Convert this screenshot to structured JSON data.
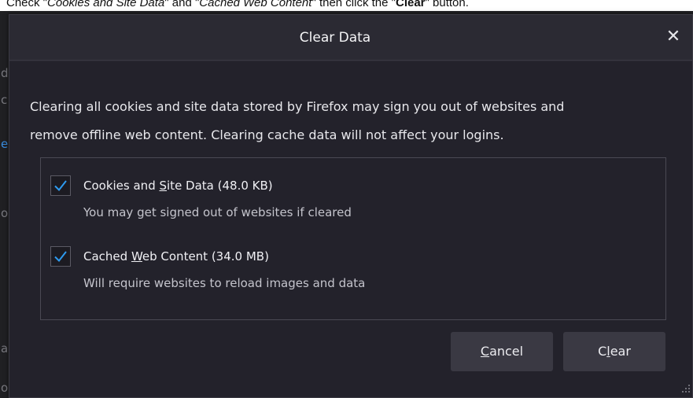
{
  "instruction": {
    "pre": "Check \"",
    "item1": "Cookies and Site Data",
    "mid": "\" and \"",
    "item2": "Cached Web Content",
    "post": "\" then click the \"",
    "button": "Clear",
    "end": "\" button."
  },
  "background_fragments": [
    "d",
    "c",
    "e",
    "o",
    "a",
    "o"
  ],
  "dialog": {
    "title": "Clear Data",
    "close_glyph": "✕",
    "description_line1": "Clearing all cookies and site data stored by Firefox may sign you out of websites and",
    "description_line2": "remove offline web content. Clearing cache data will not affect your logins.",
    "options": [
      {
        "label_pre": "Cookies and ",
        "label_accesskey": "S",
        "label_post": "ite Data (48.0 KB)",
        "description": "You may get signed out of websites if cleared",
        "checked": true
      },
      {
        "label_pre": "Cached ",
        "label_accesskey": "W",
        "label_post": "eb Content (34.0 MB)",
        "description": "Will require websites to reload images and data",
        "checked": true
      }
    ],
    "cancel_accesskey": "C",
    "cancel_rest": "ancel",
    "clear_pre": "C",
    "clear_accesskey": "l",
    "clear_post": "ear"
  },
  "colors": {
    "dialog_bg": "#2b2a33",
    "body_bg": "#23222b",
    "check_blue": "#2e9bf0",
    "button_bg": "#3a3943"
  }
}
